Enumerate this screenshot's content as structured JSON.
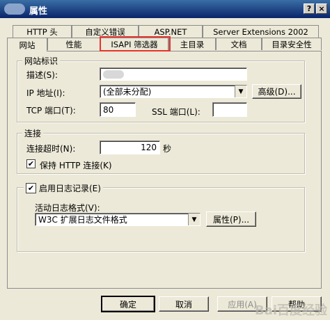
{
  "window": {
    "title": "属性",
    "help_btn": "?",
    "close_btn": "×"
  },
  "tabs_row1": [
    "HTTP 头",
    "自定义错误",
    "ASP.NET",
    "Server Extensions 2002"
  ],
  "tabs_row2": [
    "网站",
    "性能",
    "ISAPI 筛选器",
    "主目录",
    "文档",
    "目录安全性"
  ],
  "site_id": {
    "group_title": "网站标识",
    "desc_label": "描述(S):",
    "desc_value": "",
    "ip_label": "IP 地址(I):",
    "ip_value": "(全部未分配)",
    "advanced_btn": "高级(D)...",
    "tcp_label": "TCP 端口(T):",
    "tcp_value": "80",
    "ssl_label": "SSL 端口(L):",
    "ssl_value": ""
  },
  "connection": {
    "group_title": "连接",
    "timeout_label": "连接超时(N):",
    "timeout_value": "120",
    "timeout_unit": "秒",
    "keepalive_label": "保持 HTTP 连接(K)",
    "keepalive_checked": true
  },
  "logging": {
    "enable_label": "启用日志记录(E)",
    "enable_checked": true,
    "format_label": "活动日志格式(V):",
    "format_value": "W3C 扩展日志文件格式",
    "props_btn": "属性(P)..."
  },
  "footer": {
    "ok": "确定",
    "cancel": "取消",
    "apply": "应用(A)",
    "help": "帮助"
  },
  "watermark": "Bai百度经验"
}
